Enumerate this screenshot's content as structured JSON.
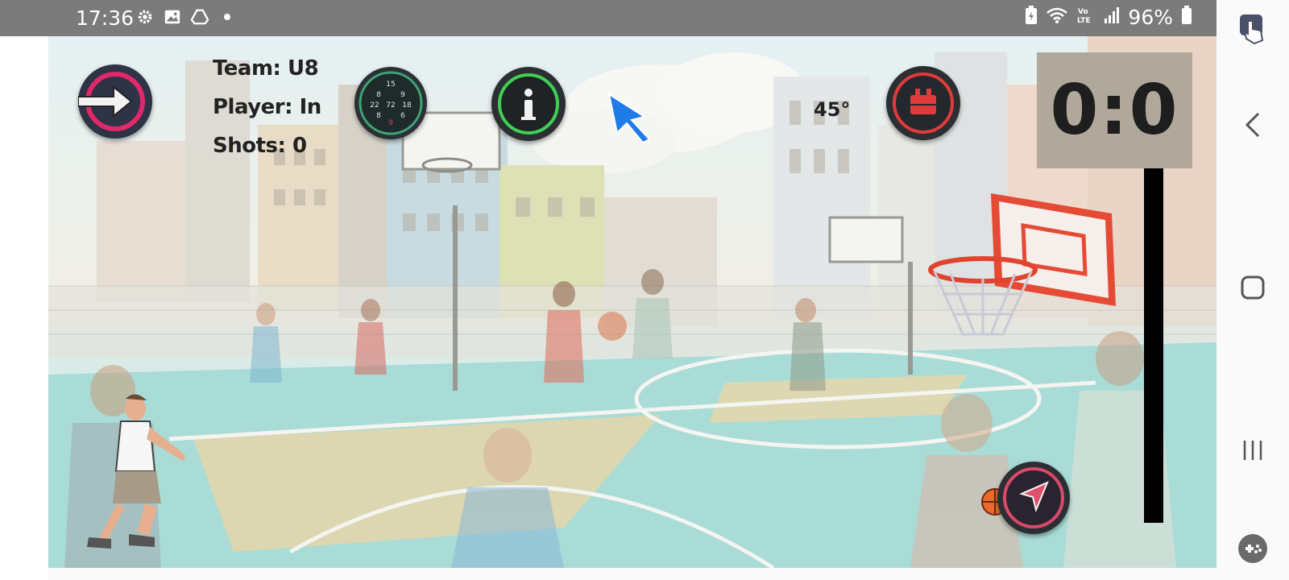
{
  "status_bar": {
    "time": "17:36",
    "battery": "96%",
    "left_icons": [
      "gear-icon",
      "image-icon",
      "drive-icon",
      "dot-icon"
    ],
    "right_icons": [
      "battery-saver-icon",
      "wifi-icon",
      "volte-icon",
      "signal-icon",
      "battery-icon"
    ]
  },
  "hud": {
    "team": "Team: U8",
    "player": "Player: In",
    "shots": "Shots: 0",
    "angle": "45°",
    "score": "0:0"
  },
  "buttons": {
    "exit": "exit-arrow-icon",
    "target": "target-grid-icon",
    "info": "info-icon",
    "pause": "pause-icon",
    "aim": "aim-arrow-icon"
  },
  "target_grid_numbers": [
    "15",
    "8",
    "9",
    "22",
    "72",
    "18",
    "8",
    "9",
    "6"
  ],
  "colors": {
    "status_bar": "#7b7b7b",
    "scoreboard": "#b0a89b",
    "power_bar": "#000000",
    "exit_ring": "#e0286a",
    "info_ring": "#3fcf52",
    "pause_ring": "#e03a3a",
    "cursor": "#1e7be8"
  }
}
